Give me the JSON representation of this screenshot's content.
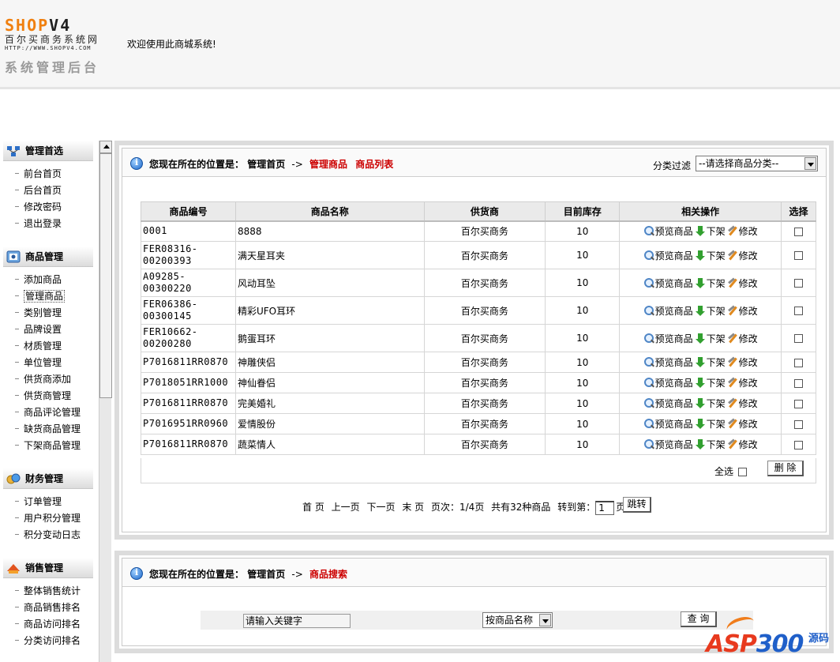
{
  "header": {
    "logo_shop": "SHOP",
    "logo_v4": "V4",
    "logo_sub": "百尔买商务系统网",
    "logo_url": "HTTP://WWW.SHOPV4.COM",
    "logo_admin": "系统管理后台",
    "welcome": "欢迎使用此商城系统!"
  },
  "sidebar": {
    "groups": [
      {
        "title": "管理首选",
        "items": [
          "前台首页",
          "后台首页",
          "修改密码",
          "退出登录"
        ]
      },
      {
        "title": "商品管理",
        "items": [
          "添加商品",
          "管理商品",
          "类别管理",
          "品牌设置",
          "材质管理",
          "单位管理",
          "供货商添加",
          "供货商管理",
          "商品评论管理",
          "缺货商品管理",
          "下架商品管理"
        ]
      },
      {
        "title": "财务管理",
        "items": [
          "订单管理",
          "用户积分管理",
          "积分变动日志"
        ]
      },
      {
        "title": "销售管理",
        "items": [
          "整体销售统计",
          "商品销售排名",
          "商品访问排名",
          "分类访问排名"
        ]
      }
    ]
  },
  "list_panel": {
    "location_label": "您现在所在的位置是：",
    "home": "管理首页",
    "arrow": "->",
    "crumb_manage": "管理商品",
    "crumb_list": "商品列表",
    "filter_label": "分类过滤",
    "filter_value": "--请选择商品分类--",
    "columns": [
      "商品编号",
      "商品名称",
      "供货商",
      "目前库存",
      "相关操作",
      "选择"
    ],
    "op_preview": "预览商品",
    "op_down": "下架",
    "op_edit": "修改",
    "rows": [
      {
        "code": "0001",
        "name": "8888",
        "supplier": "百尔买商务",
        "stock": "10"
      },
      {
        "code": "FER08316-\n00200393",
        "name": "满天星耳夹",
        "supplier": "百尔买商务",
        "stock": "10"
      },
      {
        "code": "A09285-\n00300220",
        "name": "风动耳坠",
        "supplier": "百尔买商务",
        "stock": "10"
      },
      {
        "code": "FER06386-\n00300145",
        "name": "精彩UFO耳环",
        "supplier": "百尔买商务",
        "stock": "10"
      },
      {
        "code": "FER10662-\n00200280",
        "name": "鹅蛋耳环",
        "supplier": "百尔买商务",
        "stock": "10"
      },
      {
        "code": "P7016811RR0870",
        "name": "神雕侠侣",
        "supplier": "百尔买商务",
        "stock": "10"
      },
      {
        "code": "P7018051RR1000",
        "name": "神仙眷侣",
        "supplier": "百尔买商务",
        "stock": "10"
      },
      {
        "code": "P7016811RR0870",
        "name": "完美婚礼",
        "supplier": "百尔买商务",
        "stock": "10"
      },
      {
        "code": "P7016951RR0960",
        "name": "爱情股份",
        "supplier": "百尔买商务",
        "stock": "10"
      },
      {
        "code": "P7016811RR0870",
        "name": "蔬菜情人",
        "supplier": "百尔买商务",
        "stock": "10"
      }
    ],
    "select_all": "全选",
    "delete_btn": "删 除",
    "pager": {
      "first": "首 页",
      "prev": "上一页",
      "next": "下一页",
      "last": "末 页",
      "page_info": "页次：1/4页",
      "total": "共有32种商品",
      "goto": "转到第：",
      "page_value": "1",
      "page_unit": "页",
      "jump_btn": "跳转"
    }
  },
  "search_panel": {
    "location_label": "您现在所在的位置是：",
    "home": "管理首页",
    "arrow": "->",
    "crumb": "商品搜索",
    "keyword_placeholder": "请输入关键字",
    "field_value": "按商品名称",
    "query_btn": "查 询"
  },
  "watermark": {
    "asp": "ASP",
    "num": "300",
    "side": "源码"
  }
}
